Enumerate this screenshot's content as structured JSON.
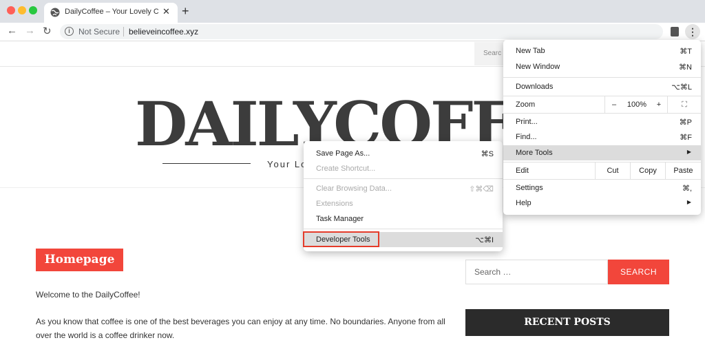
{
  "browser": {
    "tab_title": "DailyCoffee – Your Lovely Cup",
    "tab_close": "✕",
    "new_tab": "+",
    "back": "←",
    "forward": "→",
    "reload": "↻",
    "security_icon": "i",
    "security_label": "Not Secure",
    "url": "believeincoffee.xyz",
    "menu_dots": "⋮",
    "light_colors": [
      "#ff5f57",
      "#febc2e",
      "#28c840"
    ]
  },
  "page": {
    "top_search_placeholder": "Searc",
    "logo": "DAILYCOFFEE",
    "tagline": "Your Lo",
    "badge": "Homepage",
    "welcome": "Welcome to the DailyCoffee!",
    "paragraph_line1": "As you know that coffee is one of the best beverages you can enjoy at any time. No boundaries. Anyone from all",
    "paragraph_line2": "over the world is a coffee drinker now.",
    "sidebar_search_placeholder": "Search …",
    "sidebar_search_button": "SEARCH",
    "recent_posts": "RECENT POSTS",
    "accent_color": "#f2463b"
  },
  "main_menu": {
    "new_tab": "New Tab",
    "new_tab_sc": "⌘T",
    "new_window": "New Window",
    "new_window_sc": "⌘N",
    "downloads": "Downloads",
    "downloads_sc": "⌥⌘L",
    "zoom": "Zoom",
    "zoom_minus": "–",
    "zoom_value": "100%",
    "zoom_plus": "+",
    "fullscreen": "⛶",
    "print": "Print...",
    "print_sc": "⌘P",
    "find": "Find...",
    "find_sc": "⌘F",
    "more_tools": "More Tools",
    "edit": "Edit",
    "cut": "Cut",
    "copy": "Copy",
    "paste": "Paste",
    "settings": "Settings",
    "settings_sc": "⌘,",
    "help": "Help",
    "arrow": "▶"
  },
  "sub_menu": {
    "save_page": "Save Page As...",
    "save_page_sc": "⌘S",
    "create_shortcut": "Create Shortcut...",
    "clear_data": "Clear Browsing Data...",
    "clear_data_sc": "⇧⌘⌫",
    "extensions": "Extensions",
    "task_manager": "Task Manager",
    "developer_tools": "Developer Tools",
    "developer_tools_sc": "⌥⌘I"
  }
}
